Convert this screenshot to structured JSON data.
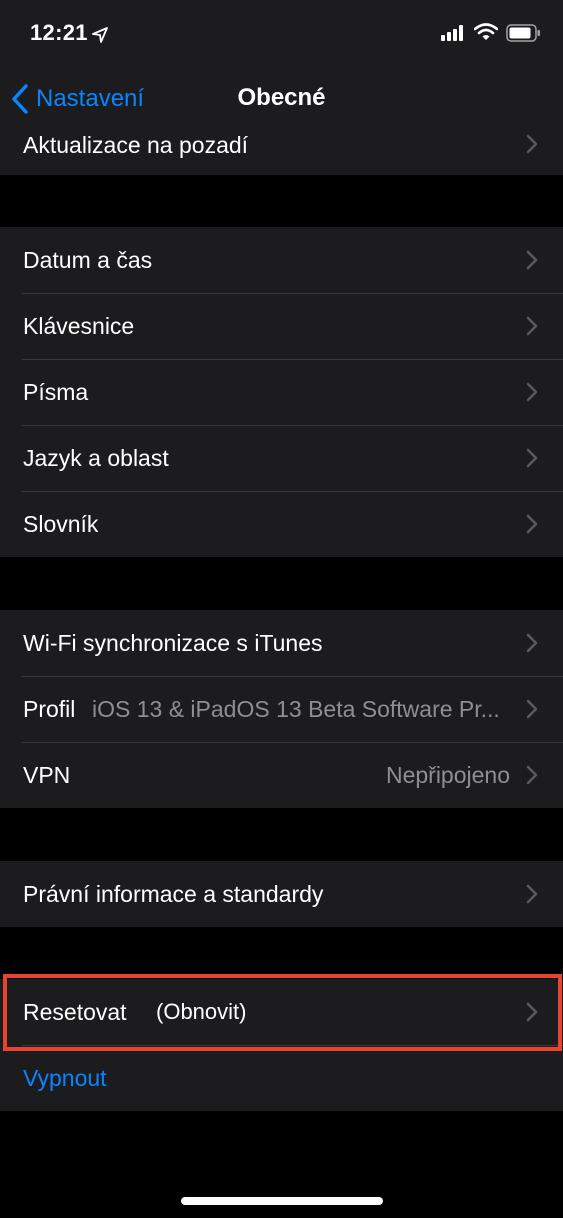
{
  "status_bar": {
    "time": "12:21",
    "icons": [
      "location-arrow-icon",
      "cellular-signal-icon",
      "wifi-icon",
      "battery-icon"
    ]
  },
  "nav": {
    "back_label": "Nastavení",
    "title": "Obecné"
  },
  "groups": [
    {
      "rows": [
        {
          "label": "Aktualizace na pozadí"
        }
      ]
    },
    {
      "rows": [
        {
          "label": "Datum a čas"
        },
        {
          "label": "Klávesnice"
        },
        {
          "label": "Písma"
        },
        {
          "label": "Jazyk a oblast"
        },
        {
          "label": "Slovník"
        }
      ]
    },
    {
      "rows": [
        {
          "label": "Wi-Fi synchronizace s iTunes"
        },
        {
          "label": "Profil",
          "value": "iOS 13 & iPadOS 13 Beta Software Pr..."
        },
        {
          "label": "VPN",
          "value": "Nepřipojeno"
        }
      ]
    },
    {
      "rows": [
        {
          "label": "Právní informace a standardy"
        }
      ]
    },
    {
      "rows": [
        {
          "label": "Resetovat",
          "annotation": "(Obnovit)"
        },
        {
          "label": "Vypnout"
        }
      ]
    }
  ],
  "colors": {
    "background": "#000000",
    "cell": "#1c1c1e",
    "separator": "#38383a",
    "accent_blue": "#0a84ff",
    "secondary_text": "#8e8e93",
    "highlight_red": "#e8432f"
  }
}
